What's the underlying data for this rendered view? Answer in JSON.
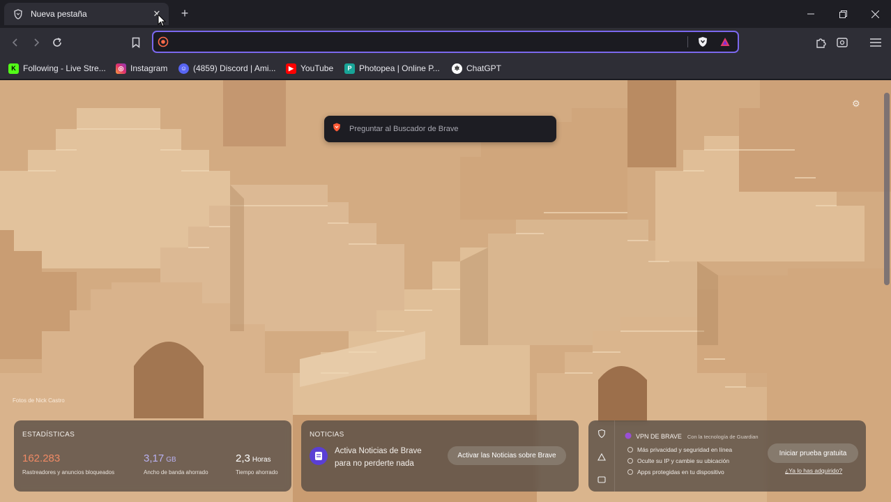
{
  "tab": {
    "title": "Nueva pestaña"
  },
  "urlbar": {
    "value": "",
    "placeholder": ""
  },
  "bookmarks": [
    {
      "label": "Following - Live Stre...",
      "icon": "kick-icon",
      "color": "#53fc18"
    },
    {
      "label": "Instagram",
      "icon": "instagram-icon",
      "color": "#e1306c"
    },
    {
      "label": "(4859) Discord | Ami...",
      "icon": "discord-icon",
      "color": "#5865f2"
    },
    {
      "label": "YouTube",
      "icon": "youtube-icon",
      "color": "#ff0000"
    },
    {
      "label": "Photopea | Online P...",
      "icon": "photopea-icon",
      "color": "#18a497"
    },
    {
      "label": "ChatGPT",
      "icon": "chatgpt-icon",
      "color": "#ffffff"
    }
  ],
  "search_popup": {
    "label": "Preguntar al Buscador de Brave"
  },
  "stats": {
    "title": "ESTADÍSTICAS",
    "items": [
      {
        "value": "162.283",
        "unit": "",
        "desc": "Rastreadores y anuncios bloqueados",
        "color": "#f08a65"
      },
      {
        "value": "3,17",
        "unit": "GB",
        "desc": "Ancho de banda ahorrado",
        "color": "#b8b0f0"
      },
      {
        "value": "2,3",
        "unit": "Horas",
        "desc": "Tiempo ahorrado",
        "color": "#ffffff"
      }
    ]
  },
  "news": {
    "title": "NOTICIAS",
    "line1": "Activa Noticias de Brave",
    "line2": "para no perderte nada",
    "button": "Activar las Noticias sobre Brave"
  },
  "vpn": {
    "title": "VPN DE BRAVE",
    "subtitle": "Con la tecnología de Guardian",
    "features": [
      "Más privacidad y seguridad en línea",
      "Oculte su IP y cambie su ubicación",
      "Apps protegidas en tu dispositivo"
    ],
    "button": "Iniciar prueba gratuita",
    "link": "¿Ya lo has adquirido?"
  },
  "photo_credit": "Fotos de Nick Castro"
}
